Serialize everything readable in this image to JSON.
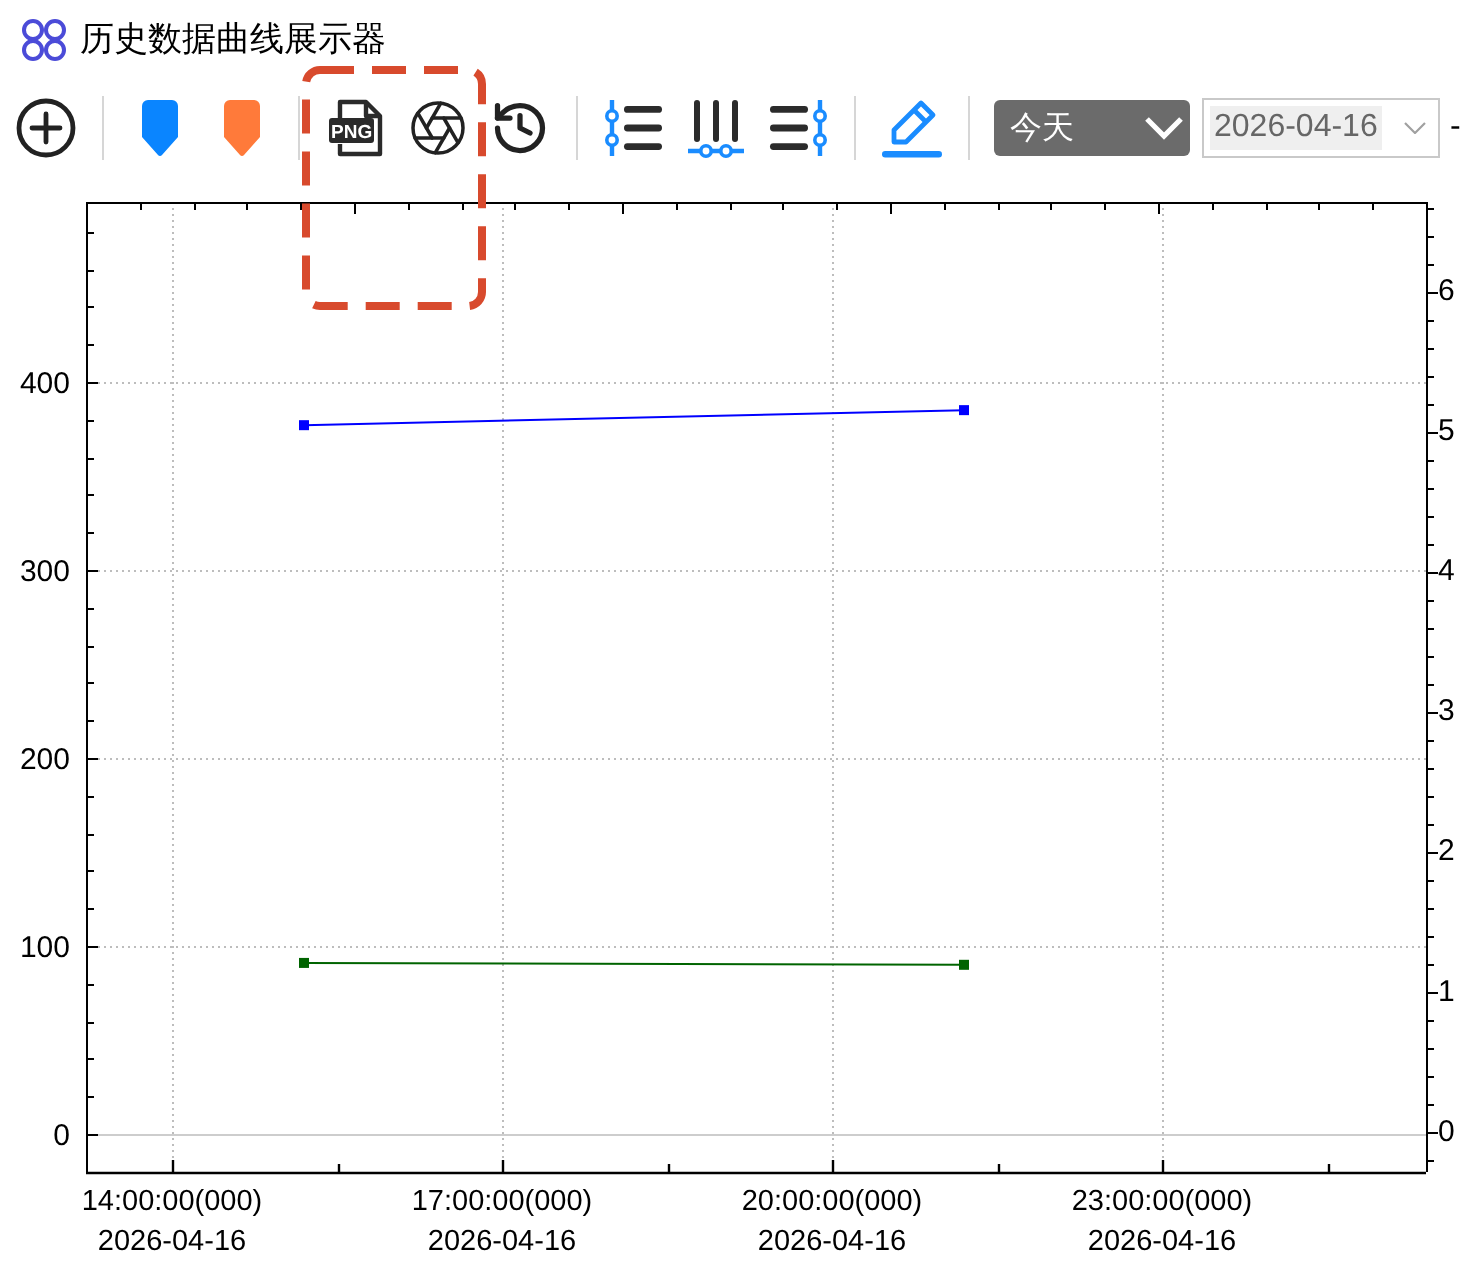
{
  "window": {
    "title": "历史数据曲线展示器"
  },
  "toolbar": {
    "groups": [
      {
        "buttons": [
          {
            "highlighted": false
          }
        ]
      },
      {
        "buttons": [
          {
            "highlighted": false
          },
          {
            "highlighted": false
          }
        ]
      },
      {
        "buttons": [
          {
            "highlighted": true,
            "icon_text": "PNG"
          },
          {
            "highlighted": true
          },
          {
            "highlighted": false
          }
        ]
      },
      {
        "buttons": [
          {
            "highlighted": false
          },
          {
            "highlighted": false
          },
          {
            "highlighted": false
          }
        ]
      },
      {
        "buttons": [
          {
            "highlighted": false
          }
        ]
      }
    ],
    "range_select": {
      "value": "今天"
    },
    "date_field": {
      "value": "2026-04-16"
    },
    "trailing_text": "-"
  },
  "chart": {
    "chart_data": {
      "type": "line",
      "grid": true,
      "categories": [
        null,
        null,
        null,
        "14:00:00(000)\n2026-04-16",
        null,
        null,
        null,
        null,
        null,
        null,
        null,
        null,
        null,
        null,
        null,
        null,
        null,
        null,
        "17:00:00(000)\n2026-04-16",
        null,
        null,
        null,
        null,
        null,
        null,
        null,
        null,
        null,
        null,
        null,
        null,
        null,
        null,
        "20:00:00(000)\n2026-04-16",
        null,
        null,
        null,
        null,
        null,
        null,
        null,
        null,
        null,
        null,
        null,
        null,
        null,
        null,
        "23:00:00(000)\n2026-04-16",
        null,
        null,
        null,
        null,
        null,
        null,
        null,
        null,
        null,
        null,
        null,
        null
      ],
      "ylim": [
        -20.2,
        495.7
      ],
      "yticks": [
        0,
        100,
        200,
        300,
        400
      ],
      "y2lim": [
        -0.28,
        6.64
      ],
      "y2ticks": [
        0,
        1,
        2,
        3,
        4,
        5,
        6
      ],
      "series": [
        {
          "color": "#0000ff",
          "marker": "square",
          "values": [
            null,
            null,
            null,
            null,
            null,
            null,
            null,
            null,
            null,
            377,
            null,
            null,
            null,
            null,
            null,
            null,
            null,
            null,
            null,
            null,
            null,
            null,
            null,
            null,
            null,
            null,
            null,
            null,
            null,
            null,
            null,
            null,
            null,
            null,
            null,
            null,
            null,
            null,
            null,
            385,
            null,
            null,
            null,
            null,
            null,
            null,
            null,
            null,
            null,
            null,
            null,
            null,
            null,
            null,
            null,
            null,
            null,
            null,
            null,
            null,
            null
          ]
        },
        {
          "color": "#006400",
          "marker": "square",
          "values": [
            null,
            null,
            null,
            null,
            null,
            null,
            null,
            null,
            null,
            91,
            null,
            null,
            null,
            null,
            null,
            null,
            null,
            null,
            null,
            null,
            null,
            null,
            null,
            null,
            null,
            null,
            null,
            null,
            null,
            null,
            null,
            null,
            null,
            null,
            null,
            null,
            null,
            null,
            null,
            90,
            null,
            null,
            null,
            null,
            null,
            null,
            null,
            null,
            null,
            null,
            null,
            null,
            null,
            null,
            null,
            null,
            null,
            null,
            null,
            null,
            null
          ]
        }
      ]
    }
  }
}
